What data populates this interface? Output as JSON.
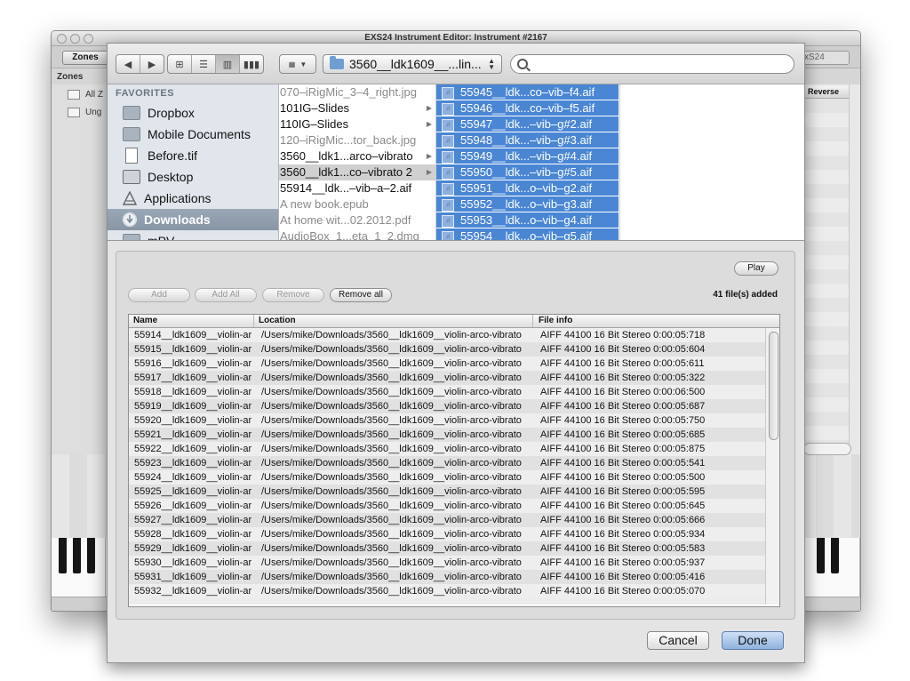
{
  "window": {
    "title": "EXS24 Instrument Editor: Instrument #2167",
    "zones_button": "Zones",
    "right_button": "xS24",
    "zones_label": "Zones",
    "left_items": [
      "All Z",
      "Ung"
    ],
    "reverse_header": "Reverse"
  },
  "sidebar": {
    "header": "FAVORITES",
    "items": [
      {
        "label": "Dropbox",
        "icon": "folder-icon"
      },
      {
        "label": "Mobile Documents",
        "icon": "folder-icon"
      },
      {
        "label": "Before.tif",
        "icon": "document-icon"
      },
      {
        "label": "Desktop",
        "icon": "desktop-icon"
      },
      {
        "label": "Applications",
        "icon": "applications-icon"
      },
      {
        "label": "Downloads",
        "icon": "downloads-icon"
      },
      {
        "label": "mPV",
        "icon": "folder-icon"
      }
    ],
    "selected": "Downloads"
  },
  "toolbar": {
    "path": "3560__ldk1609__...lin..."
  },
  "column1": [
    {
      "label": "070–iRigMic_3–4_right.jpg",
      "dim": true,
      "folder": false
    },
    {
      "label": "101IG–Slides",
      "dim": false,
      "folder": true
    },
    {
      "label": "110IG–Slides",
      "dim": false,
      "folder": true
    },
    {
      "label": "120–iRigMic...tor_back.jpg",
      "dim": true,
      "folder": false
    },
    {
      "label": "3560__ldk1...arco–vibrato",
      "dim": false,
      "folder": true
    },
    {
      "label": "3560__ldk1...co–vibrato 2",
      "dim": false,
      "folder": true,
      "selected": true
    },
    {
      "label": "55914__ldk...–vib–a–2.aif",
      "dim": false,
      "folder": false
    },
    {
      "label": "A new book.epub",
      "dim": true,
      "folder": false
    },
    {
      "label": "At home wit...02.2012.pdf",
      "dim": true,
      "folder": false
    },
    {
      "label": "AudioBox_1...eta_1_2.dmg",
      "dim": true,
      "folder": false
    }
  ],
  "column2": [
    "55945__ldk...co–vib–f4.aif",
    "55946__ldk...co–vib–f5.aif",
    "55947__ldk...–vib–g#2.aif",
    "55948__ldk...–vib–g#3.aif",
    "55949__ldk...–vib–g#4.aif",
    "55950__ldk...–vib–g#5.aif",
    "55951__ldk...o–vib–g2.aif",
    "55952__ldk...o–vib–g3.aif",
    "55953__ldk...o–vib–g4.aif",
    "55954__ldk...o–vib–g5.aif"
  ],
  "accessory": {
    "play": "Play",
    "add": "Add",
    "add_all": "Add All",
    "remove": "Remove",
    "remove_all": "Remove all",
    "files_added": "41 file(s) added"
  },
  "table": {
    "headers": [
      "Name",
      "Location",
      "File info"
    ],
    "rows": [
      [
        "55914__ldk1609__violin-ar",
        "/Users/mike/Downloads/3560__ldk1609__violin-arco-vibrato",
        "AIFF   44100   16 Bit   Stereo   0:00:05:718"
      ],
      [
        "55915__ldk1609__violin-ar",
        "/Users/mike/Downloads/3560__ldk1609__violin-arco-vibrato",
        "AIFF   44100   16 Bit   Stereo   0:00:05:604"
      ],
      [
        "55916__ldk1609__violin-ar",
        "/Users/mike/Downloads/3560__ldk1609__violin-arco-vibrato",
        "AIFF   44100   16 Bit   Stereo   0:00:05:611"
      ],
      [
        "55917__ldk1609__violin-ar",
        "/Users/mike/Downloads/3560__ldk1609__violin-arco-vibrato",
        "AIFF   44100   16 Bit   Stereo   0:00:05:322"
      ],
      [
        "55918__ldk1609__violin-ar",
        "/Users/mike/Downloads/3560__ldk1609__violin-arco-vibrato",
        "AIFF   44100   16 Bit   Stereo   0:00:06:500"
      ],
      [
        "55919__ldk1609__violin-ar",
        "/Users/mike/Downloads/3560__ldk1609__violin-arco-vibrato",
        "AIFF   44100   16 Bit   Stereo   0:00:05:687"
      ],
      [
        "55920__ldk1609__violin-ar",
        "/Users/mike/Downloads/3560__ldk1609__violin-arco-vibrato",
        "AIFF   44100   16 Bit   Stereo   0:00:05:750"
      ],
      [
        "55921__ldk1609__violin-ar",
        "/Users/mike/Downloads/3560__ldk1609__violin-arco-vibrato",
        "AIFF   44100   16 Bit   Stereo   0:00:05:685"
      ],
      [
        "55922__ldk1609__violin-ar",
        "/Users/mike/Downloads/3560__ldk1609__violin-arco-vibrato",
        "AIFF   44100   16 Bit   Stereo   0:00:05:875"
      ],
      [
        "55923__ldk1609__violin-ar",
        "/Users/mike/Downloads/3560__ldk1609__violin-arco-vibrato",
        "AIFF   44100   16 Bit   Stereo   0:00:05:541"
      ],
      [
        "55924__ldk1609__violin-ar",
        "/Users/mike/Downloads/3560__ldk1609__violin-arco-vibrato",
        "AIFF   44100   16 Bit   Stereo   0:00:05:500"
      ],
      [
        "55925__ldk1609__violin-ar",
        "/Users/mike/Downloads/3560__ldk1609__violin-arco-vibrato",
        "AIFF   44100   16 Bit   Stereo   0:00:05:595"
      ],
      [
        "55926__ldk1609__violin-ar",
        "/Users/mike/Downloads/3560__ldk1609__violin-arco-vibrato",
        "AIFF   44100   16 Bit   Stereo   0:00:05:645"
      ],
      [
        "55927__ldk1609__violin-ar",
        "/Users/mike/Downloads/3560__ldk1609__violin-arco-vibrato",
        "AIFF   44100   16 Bit   Stereo   0:00:05:666"
      ],
      [
        "55928__ldk1609__violin-ar",
        "/Users/mike/Downloads/3560__ldk1609__violin-arco-vibrato",
        "AIFF   44100   16 Bit   Stereo   0:00:05:934"
      ],
      [
        "55929__ldk1609__violin-ar",
        "/Users/mike/Downloads/3560__ldk1609__violin-arco-vibrato",
        "AIFF   44100   16 Bit   Stereo   0:00:05:583"
      ],
      [
        "55930__ldk1609__violin-ar",
        "/Users/mike/Downloads/3560__ldk1609__violin-arco-vibrato",
        "AIFF   44100   16 Bit   Stereo   0:00:05:937"
      ],
      [
        "55931__ldk1609__violin-ar",
        "/Users/mike/Downloads/3560__ldk1609__violin-arco-vibrato",
        "AIFF   44100   16 Bit   Stereo   0:00:05:416"
      ],
      [
        "55932__ldk1609__violin-ar",
        "/Users/mike/Downloads/3560__ldk1609__violin-arco-vibrato",
        "AIFF   44100   16 Bit   Stereo   0:00:05:070"
      ]
    ]
  },
  "buttons": {
    "cancel": "Cancel",
    "done": "Done"
  }
}
